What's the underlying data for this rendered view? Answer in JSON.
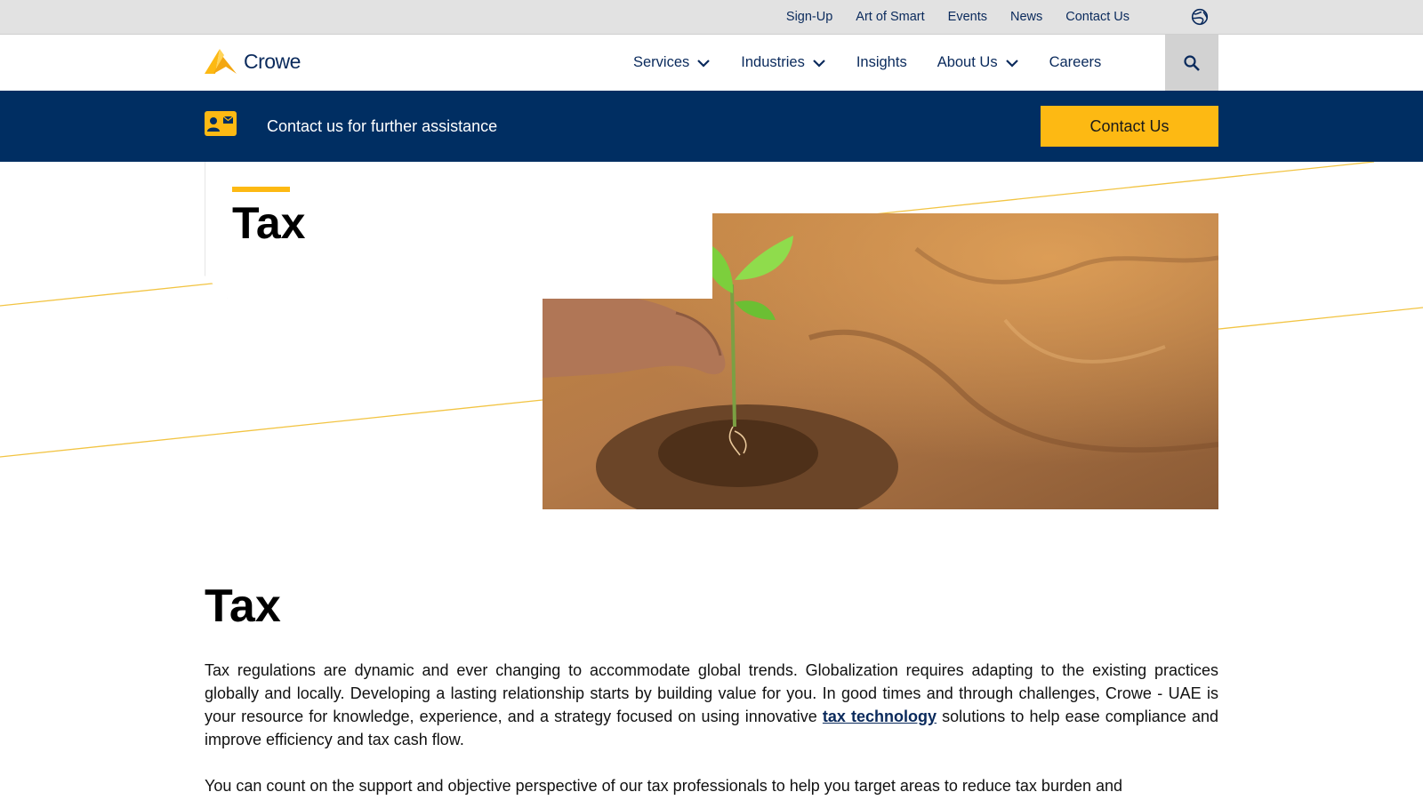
{
  "utility_nav": {
    "links": [
      "Sign-Up",
      "Art of Smart",
      "Events",
      "News",
      "Contact Us"
    ]
  },
  "brand": {
    "name": "Crowe",
    "color": "#0a2a5c",
    "accent": "#fdb913"
  },
  "main_nav": {
    "items": [
      {
        "label": "Services",
        "dropdown": true
      },
      {
        "label": "Industries",
        "dropdown": true
      },
      {
        "label": "Insights",
        "dropdown": false
      },
      {
        "label": "About Us",
        "dropdown": true
      },
      {
        "label": "Careers",
        "dropdown": false
      }
    ]
  },
  "banner": {
    "text": "Contact us for further assistance",
    "button_label": "Contact Us",
    "background": "#002e62"
  },
  "hero": {
    "title": "Tax"
  },
  "content": {
    "title": "Tax",
    "para1_before": "Tax regulations are dynamic and ever changing to accommodate global trends. Globalization requires adapting to the existing practices globally and locally. Developing a lasting relationship starts by building value for you. In good times and through challenges, Crowe - UAE is your resource for knowledge, experience, and a strategy focused on using innovative ",
    "para1_link": "tax technology",
    "para1_after": " solutions to help ease compliance and improve efficiency and tax cash flow.",
    "para2": "You can count on the support and objective perspective of our tax professionals to help you target areas to reduce tax burden and"
  }
}
